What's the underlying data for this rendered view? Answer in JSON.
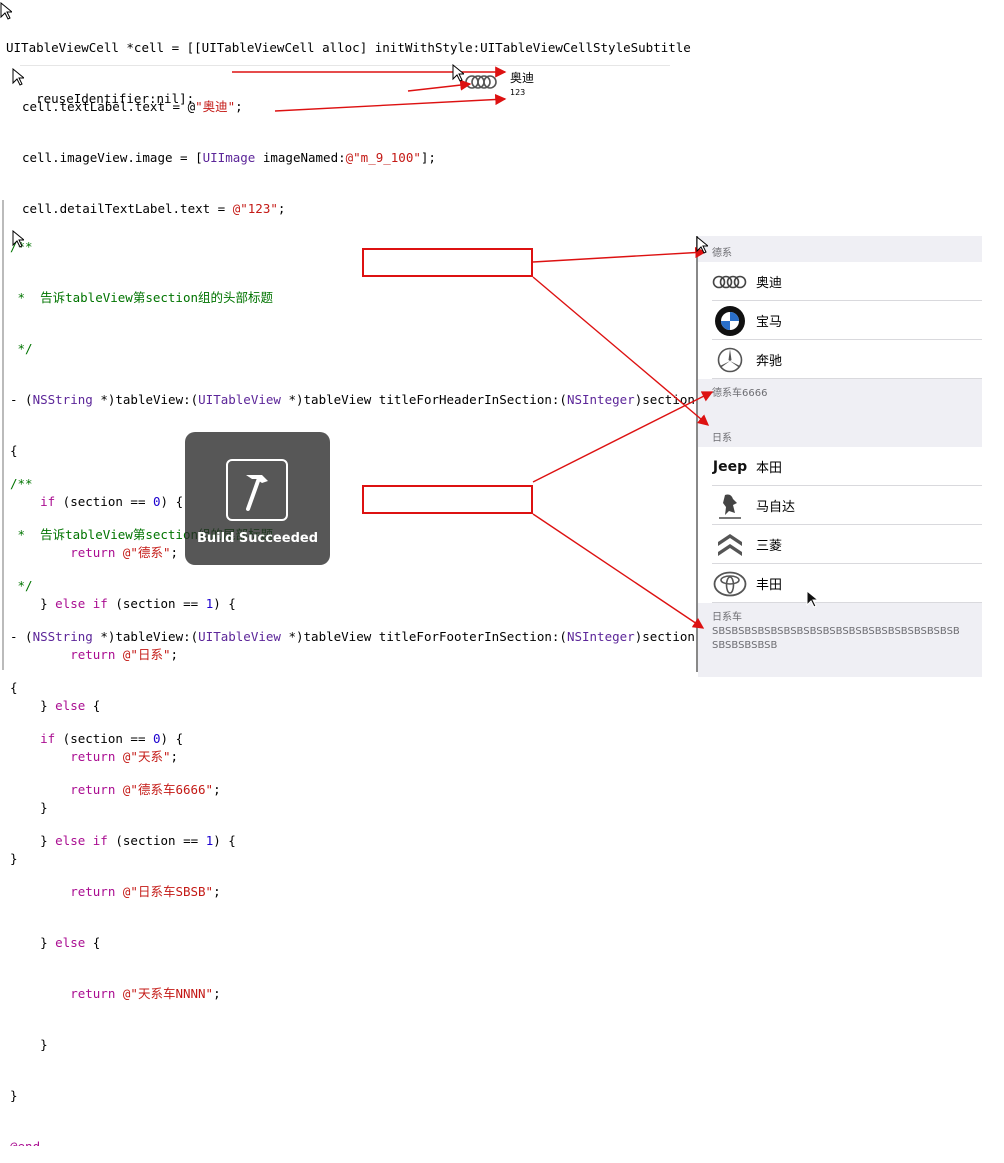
{
  "top_code": {
    "l1": "UITableViewCell *cell = [[UITableViewCell alloc] initWithStyle:UITableViewCellStyleSubtitle",
    "l2": "    reuseIdentifier:nil];",
    "l3a": "cell.textLabel.text = @",
    "l3b": "\"奥迪\"",
    "l3c": ";",
    "l4a": "cell.imageView.image = [",
    "l4b": "UIImage",
    "l4c": " imageNamed:",
    "l4d": "@\"m_9_100\"",
    "l4e": "];",
    "l5a": "cell.detailTextLabel.text = ",
    "l5b": "@\"123\"",
    "l5c": ";"
  },
  "preview_cell": {
    "title": "奥迪",
    "detail": "123"
  },
  "header_block": {
    "c1": "/**",
    "c2": " *  告诉tableView第section组的头部标题",
    "c3": " */",
    "sig_a": "- (",
    "sig_b": "NSString",
    "sig_c": " *)tableView:(",
    "sig_d": "UITableView",
    "sig_e": " *)tableView ",
    "sig_f": "titleForHeaderInSection",
    "sig_g": ":(",
    "sig_h": "NSInteger",
    "sig_i": ")section",
    "brace_open": "{",
    "b1a": "    if",
    "b1b": " (section == ",
    "b1c": "0",
    "b1d": ") {",
    "b2a": "        return ",
    "b2b": "@\"德系\"",
    "b2c": ";",
    "b3a": "    } ",
    "b3b": "else if",
    "b3c": " (section == ",
    "b3d": "1",
    "b3e": ") {",
    "b4a": "        return ",
    "b4b": "@\"日系\"",
    "b4c": ";",
    "b5a": "    } ",
    "b5b": "else",
    "b5c": " {",
    "b6a": "        return ",
    "b6b": "@\"天系\"",
    "b6c": ";",
    "b7": "    }",
    "brace_close": "}"
  },
  "footer_block": {
    "c1": "/**",
    "c2": " *  告诉tableView第section组的尾部标题",
    "c3": " */",
    "sig_a": "- (",
    "sig_b": "NSString",
    "sig_c": " *)tableView:(",
    "sig_d": "UITableView",
    "sig_e": " *)tableView ",
    "sig_f": "titleForFooterInSection",
    "sig_g": ":(",
    "sig_h": "NSInteger",
    "sig_i": ")section",
    "brace_open": "{",
    "b1a": "    if",
    "b1b": " (section == ",
    "b1c": "0",
    "b1d": ") {",
    "b2a": "        return ",
    "b2b": "@\"德系车6666\"",
    "b2c": ";",
    "b3a": "    } ",
    "b3b": "else if",
    "b3c": " (section == ",
    "b3d": "1",
    "b3e": ") {",
    "b4a": "        return ",
    "b4b": "@\"日系车SBSB\"",
    "b4c": ";",
    "b5a": "    } ",
    "b5b": "else",
    "b5c": " {",
    "b6a": "        return ",
    "b6b": "@\"天系车NNNN\"",
    "b6c": ";",
    "b7": "    }",
    "brace_close": "}",
    "end": "@end"
  },
  "toast": {
    "label": "Build Succeeded",
    "icon": "hammer-icon"
  },
  "simulator": {
    "section1_header": "德系",
    "section1_rows": [
      {
        "label": "奥迪",
        "icon": "audi-logo-icon"
      },
      {
        "label": "宝马",
        "icon": "bmw-logo-icon"
      },
      {
        "label": "奔驰",
        "icon": "mercedes-logo-icon"
      }
    ],
    "section1_footer": "德系车6666",
    "section2_header": "日系",
    "section2_rows": [
      {
        "label": "本田",
        "icon": "jeep-logo-icon"
      },
      {
        "label": "马自达",
        "icon": "peugeot-logo-icon"
      },
      {
        "label": "三菱",
        "icon": "citroen-logo-icon"
      },
      {
        "label": "丰田",
        "icon": "toyota-logo-icon"
      }
    ],
    "section2_footer": "日系车\nSBSBSBSBSBSBSBSBSBSBSBSBSBSBSBSBSBSBSB\nSBSBSBSBSB"
  },
  "colors": {
    "annotation_red": "#dd1111",
    "keyword": "#aa0d91",
    "string": "#c41a16",
    "comment": "#007400"
  }
}
